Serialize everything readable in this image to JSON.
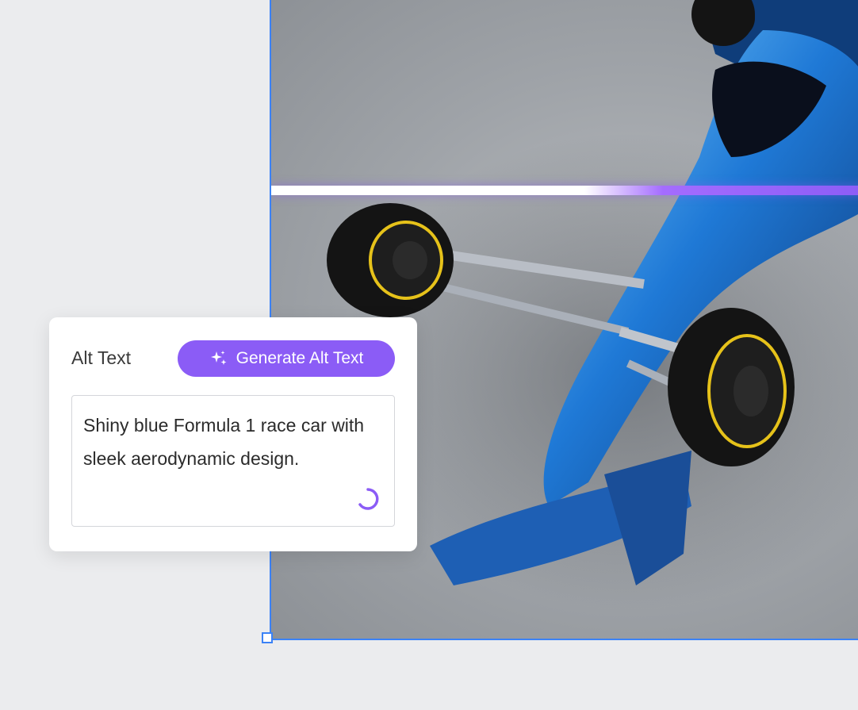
{
  "alt_panel": {
    "label": "Alt Text",
    "generate_button_label": "Generate Alt Text",
    "generate_icon": "sparkle-icon",
    "alt_text_value": "Shiny blue Formula 1 race car with sleek aerodynamic design.",
    "loading_icon": "loading-spinner-icon"
  },
  "colors": {
    "accent": "#8b5cf6",
    "selection": "#3b82f6",
    "background": "#ebecee"
  }
}
